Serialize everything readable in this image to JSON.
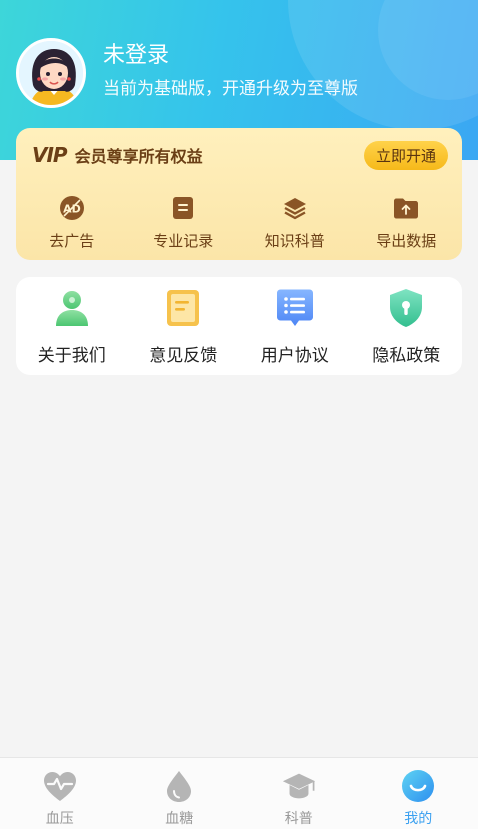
{
  "profile": {
    "name": "未登录",
    "subtitle": "当前为基础版，开通升级为至尊版"
  },
  "vip": {
    "logo": "VIP",
    "title": "会员尊享所有权益",
    "button": "立即开通",
    "items": [
      {
        "label": "去广告",
        "icon": "ad-icon"
      },
      {
        "label": "专业记录",
        "icon": "record-icon"
      },
      {
        "label": "知识科普",
        "icon": "layers-icon"
      },
      {
        "label": "导出数据",
        "icon": "export-folder-icon"
      }
    ],
    "icon_badge_text": "AD"
  },
  "menu": {
    "items": [
      {
        "label": "关于我们",
        "icon": "person-icon"
      },
      {
        "label": "意见反馈",
        "icon": "feedback-doc-icon"
      },
      {
        "label": "用户协议",
        "icon": "agreement-icon"
      },
      {
        "label": "隐私政策",
        "icon": "shield-icon"
      }
    ]
  },
  "tabbar": {
    "items": [
      {
        "label": "血压",
        "icon": "heart-pulse-icon"
      },
      {
        "label": "血糖",
        "icon": "drop-icon"
      },
      {
        "label": "科普",
        "icon": "graduation-cap-icon"
      },
      {
        "label": "我的",
        "icon": "smile-icon"
      }
    ],
    "active_index": 3
  },
  "colors": {
    "header_gradient_start": "#3dd6d9",
    "header_gradient_end": "#3aa7f3",
    "vip_brown": "#6b3f16",
    "vip_button": "#f6b91a",
    "tab_active": "#3aa0f0",
    "tab_inactive": "#999999"
  }
}
